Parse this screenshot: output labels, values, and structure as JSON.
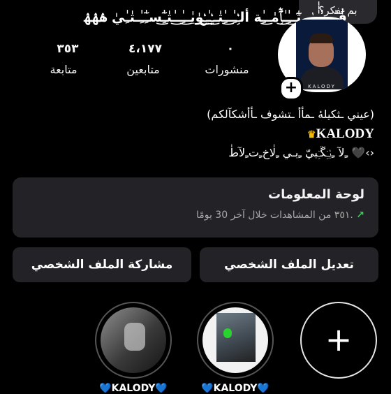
{
  "thought_bubble": {
    "text": "بم تفكر؟"
  },
  "profile": {
    "display_name": "فَٰ͜ـِٰـ͜ــِٰـٰٰٰ͜ﮧِٰـ͜ـتٰٓٓـ͜ـِٰٰـٰ͜ﭑِٰٰٓمٰـ͜ـِٰة ألـِٰۛـِٰٰـ͜ـِٰٰتٰـ͜ـِٰۛـٰ͜ـِٰۛ͜وٰيٰـ͜ـِٰـ͜ـٰتٰـِٰٰٓ͜سـِٰٰٓـِٰٰـتٰـِٰيٰ ۿۿۿ",
    "avatar_brand": "KALODY"
  },
  "stats": {
    "posts": {
      "value": "٠",
      "label": "منشورات"
    },
    "followers": {
      "value": "٤،١٧٧",
      "label": "متابعين"
    },
    "following": {
      "value": "٣٥٣",
      "label": "متابعة"
    }
  },
  "bio": {
    "line1": "(عيني ـثكيلهٔ ـمأأ ـتشوف ـأأشكآلكم)",
    "line2": "KALODY",
    "line3": "ﹻلآ ﹻبٰۛـِۛڱـِۛبيّ ﹻبـي ﹻلٰاخﹻتﹻلآطٰ 🖤‹›"
  },
  "dashboard": {
    "title": "لوحة المعلومات",
    "arrow": "↗",
    "subtitle": "٣٥١ من المشاهدات خلال آخر 30 يومًا."
  },
  "buttons": {
    "edit_profile": "تعديل الملف الشخصي",
    "share_profile": "مشاركة الملف الشخصي"
  },
  "highlights": {
    "new_symbol": "+",
    "items": [
      {
        "label": "💙KALODY💙"
      },
      {
        "label": "💙KALODY💙"
      }
    ]
  },
  "colors": {
    "background": "#000000",
    "card": "#232327",
    "accent_arrow": "#2fd34e",
    "crown": "#f0b90b"
  },
  "icons": [
    "plus-icon",
    "crown-icon",
    "trend-up-arrow-icon"
  ]
}
